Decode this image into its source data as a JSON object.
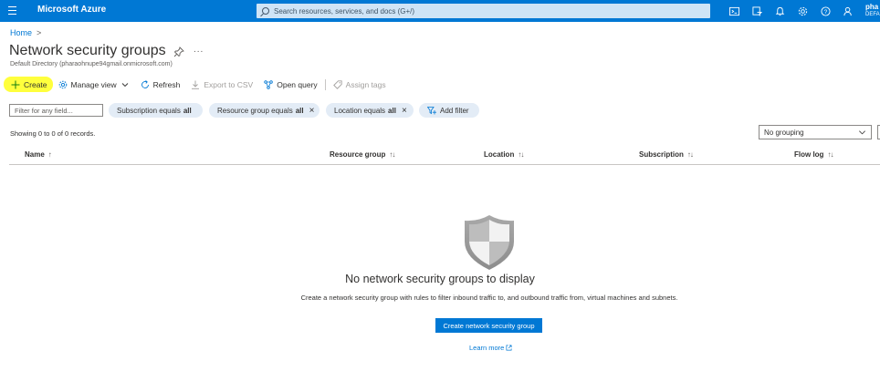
{
  "topbar": {
    "brand": "Microsoft Azure",
    "search_placeholder": "Search resources, services, and docs (G+/)",
    "user_name": "pha",
    "user_sub": "DEFA",
    "icons": [
      "cloud-shell-icon",
      "directory-filter-icon",
      "notifications-icon",
      "settings-icon",
      "help-icon",
      "feedback-icon"
    ]
  },
  "breadcrumb": {
    "home": "Home",
    "separator": ">"
  },
  "page": {
    "title": "Network security groups",
    "subtitle": "Default Directory (pharaohnupe94gmail.onmicrosoft.com)",
    "more": "..."
  },
  "commands": {
    "create": "Create",
    "manage_view": "Manage view",
    "refresh": "Refresh",
    "export_csv": "Export to CSV",
    "open_query": "Open query",
    "assign_tags": "Assign tags"
  },
  "filters": {
    "placeholder": "Filter for any field...",
    "subscription": {
      "label": "Subscription equals",
      "value": "all"
    },
    "resource_group": {
      "label": "Resource group equals",
      "value": "all"
    },
    "location": {
      "label": "Location equals",
      "value": "all"
    },
    "add_filter": "Add filter"
  },
  "records_text": "Showing 0 to 0 of 0 records.",
  "grouping": {
    "selected": "No grouping"
  },
  "table": {
    "columns": [
      {
        "label": "Name",
        "sort": "↑"
      },
      {
        "label": "Resource group",
        "sort": "↑↓"
      },
      {
        "label": "Location",
        "sort": "↑↓"
      },
      {
        "label": "Subscription",
        "sort": "↑↓"
      },
      {
        "label": "Flow log",
        "sort": "↑↓"
      }
    ]
  },
  "empty_state": {
    "title": "No network security groups to display",
    "description": "Create a network security group with rules to filter inbound traffic to, and outbound traffic from, virtual machines and subnets.",
    "button": "Create network security group",
    "link": "Learn more"
  },
  "colors": {
    "accent": "#0078d4",
    "highlight": "#ffff3d",
    "pill": "#e3ecf6"
  }
}
